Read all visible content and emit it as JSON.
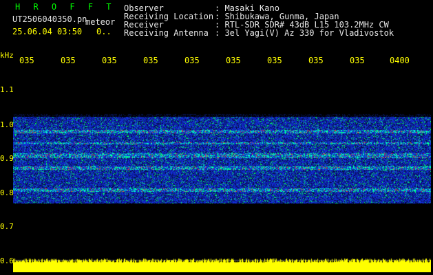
{
  "header": {
    "brand": "H R O F F T",
    "filename": "UT2506040350.pn",
    "detector": "meteor",
    "datetime": "25.06.04 03:50",
    "counter": "0..",
    "meta": [
      {
        "label": "Observer",
        "value": "Masaki Kano"
      },
      {
        "label": "Receiving Location",
        "value": "Shibukawa, Gunma, Japan"
      },
      {
        "label": "Receiver",
        "value": "RTL-SDR SDR# 43dB L15 103.2MHz CW"
      },
      {
        "label": "Receiving Antenna",
        "value": "3el Yagi(V) Az 330 for Vladivostok"
      }
    ]
  },
  "axis": {
    "unit": "kHz",
    "time_ticks": [
      "035",
      "035",
      "035",
      "035",
      "035",
      "035",
      "035",
      "035",
      "035",
      "0400"
    ],
    "freq_ticks": [
      "1.1",
      "1.0",
      "0.9",
      "0.8",
      "0.7",
      "0.6"
    ]
  },
  "colors": {
    "label": "#00ff00",
    "tick": "#ffff00",
    "value": "#e8e8e8",
    "noise_band": "#0b1f9c",
    "signal_strong": "#00ff60",
    "signal_peak": "#ff3030",
    "amplitude": "#ffff00"
  }
}
